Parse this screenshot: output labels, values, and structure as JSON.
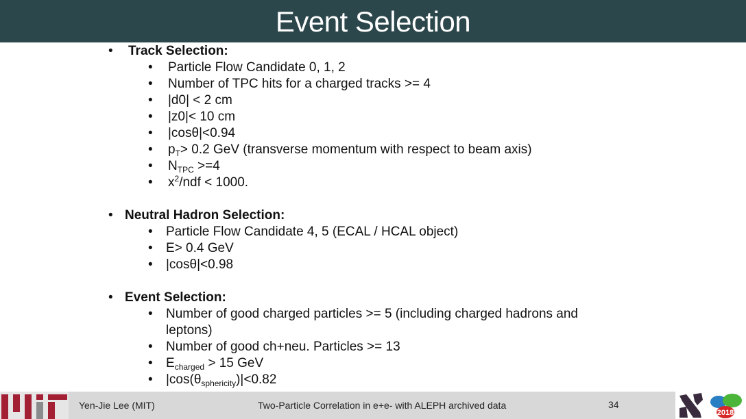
{
  "slide": {
    "title": "Event Selection",
    "colors": {
      "title_bar": "#2c474b",
      "footer_bar": "#d8d8d8",
      "mit_red": "#a31f34",
      "mit_gray": "#8a8b8c"
    }
  },
  "sections": {
    "track": {
      "heading": "Track Selection:",
      "items": {
        "0": {
          "text": "Particle Flow Candidate 0, 1, 2"
        },
        "1": {
          "text": "Number of TPC hits for a charged tracks >= 4"
        },
        "2": {
          "text": "|d0| < 2 cm"
        },
        "3": {
          "text": "|z0|< 10 cm"
        },
        "4": {
          "text": "|cosθ|<0.94"
        },
        "5": {
          "pre": "p",
          "sub": "T",
          "post": "> 0.2 GeV  (transverse momentum with respect to beam axis)"
        },
        "6": {
          "pre": "N",
          "sub": "TPC",
          "post": " >=4"
        },
        "7": {
          "pre": "x",
          "sup": "2",
          "post": "/ndf < 1000."
        }
      }
    },
    "neutral": {
      "heading": "Neutral Hadron Selection:",
      "items": {
        "0": {
          "text": "Particle Flow Candidate 4, 5 (ECAL / HCAL object)"
        },
        "1": {
          "text": "E> 0.4 GeV"
        },
        "2": {
          "text": "|cosθ|<0.98"
        }
      }
    },
    "event": {
      "heading": "Event Selection:",
      "items": {
        "0": {
          "text": "Number of good charged particles >= 5  (including charged hadrons and leptons)"
        },
        "1": {
          "text": "Number of good ch+neu. Particles >= 13"
        },
        "2": {
          "pre": "E",
          "sub": "charged",
          "post": " > 15 GeV"
        },
        "3": {
          "pre": "|cos(θ",
          "sub": "sphericity",
          "post": ")|<0.82"
        }
      }
    }
  },
  "footer": {
    "author": "Yen-Jie Lee (MIT)",
    "talk_title": "Two-Particle Correlation in e+e- with ALEPH archived data",
    "page_number": "34",
    "logos": {
      "left": "MIT",
      "right_1": "ALEPH",
      "right_2_year": "2018"
    }
  },
  "bullet": "•"
}
